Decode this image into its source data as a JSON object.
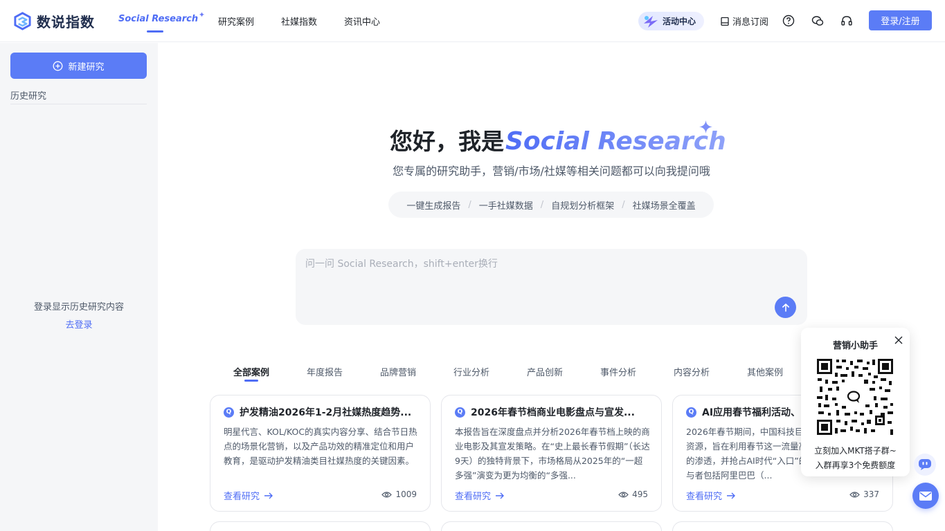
{
  "header": {
    "logo_text": "数说指数",
    "nav_active": "Social Research",
    "nav_items": [
      "研究案例",
      "社媒指数",
      "资讯中心"
    ],
    "activity_label": "活动中心",
    "subscribe_label": "消息订阅",
    "login_label": "登录/注册",
    "icons": [
      "help-icon",
      "wechat-icon",
      "headset-icon"
    ]
  },
  "sidebar": {
    "new_button": "新建研究",
    "history_title": "历史研究",
    "login_hint": "登录显示历史研究内容",
    "login_link": "去登录"
  },
  "hero": {
    "greeting": "您好，我是",
    "product": "Social Research",
    "subtitle": "您专属的研究助手，营销/市场/社媒等相关问题都可以向我提问哦",
    "features": [
      "一键生成报告",
      "一手社媒数据",
      "自规划分析框架",
      "社媒场景全覆盖"
    ]
  },
  "chat": {
    "placeholder": "问一问 Social Research，shift+enter换行"
  },
  "categories": {
    "active": "全部案例",
    "items": [
      "全部案例",
      "年度报告",
      "品牌营销",
      "行业分析",
      "产品创新",
      "事件分析",
      "内容分析",
      "其他案例"
    ]
  },
  "cards": [
    {
      "title": "护发精油2026年1-2月社媒热度趋势...",
      "body": "明星代言、KOL/KOC的真实内容分享、结合节日热点的场景化营销，以及产品功效的精准定位和用户教育，是驱动护发精油类目社媒热度的关键因素。",
      "link": "查看研究",
      "views": "1009"
    },
    {
      "title": "2026年春节档商业电影盘点与宣发...",
      "body": "本报告旨在深度盘点并分析2026年春节档上映的商业电影及其宣发策略。在“史上最长春节假期”（长达9天）的独特背景下，市场格局从2025年的“一超多强”演变为更为均衡的“多强...",
      "link": "查看研究",
      "views": "495"
    },
    {
      "title": "AI应用春节福利活动、",
      "body": "2026年春节期间，中国科技巨头投入了巨额资金和资源，旨在利用春节这一流量高峰期，加速AI应用的渗透，并抢占AI时代“入口”的战略地位。主要参与者包括阿里巴巴（...",
      "link": "查看研究",
      "views": "337"
    }
  ],
  "helper": {
    "title": "营销小助手",
    "line1": "立刻加入MKT搭子群~",
    "line2": "入群再享3个免费额度"
  },
  "colors": {
    "accent": "#5b7cf6",
    "link": "#4f6df5",
    "sidebar_bg": "#f5f6f8"
  }
}
